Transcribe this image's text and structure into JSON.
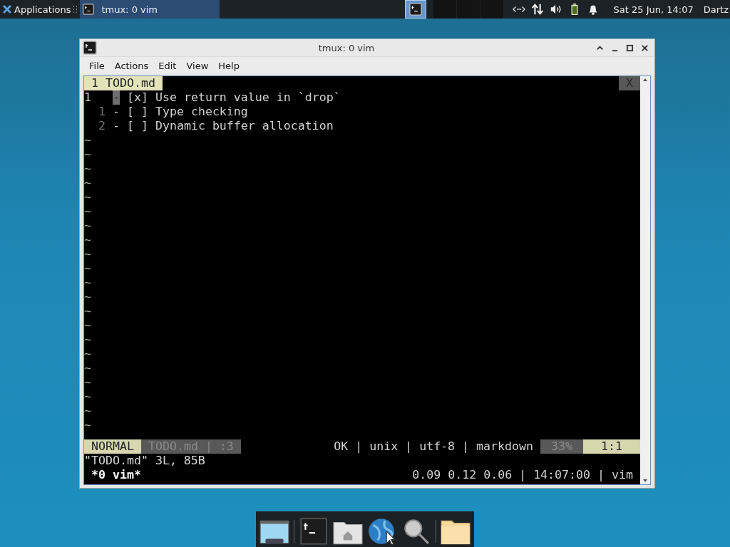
{
  "top_panel": {
    "applications": "Applications",
    "tasks": [
      {
        "title": "tmux: 0 vim",
        "selected": true
      }
    ],
    "workspaces": [
      {
        "selected": true
      },
      {
        "selected": false
      },
      {
        "selected": false
      },
      {
        "selected": false
      }
    ],
    "clock": "Sat 25 Jun, 14:07",
    "user": "Dartz"
  },
  "window": {
    "title": "tmux: 0 vim",
    "menu": [
      "File",
      "Actions",
      "Edit",
      "View",
      "Help"
    ],
    "terminal": {
      "tabs": [
        {
          "label": "1 TODO.md",
          "selected": true
        }
      ],
      "tab_close": "X",
      "lines": [
        {
          "number": "1",
          "marker": "-",
          "text": "[x] Use return value in `drop`",
          "current": true
        },
        {
          "number": "1",
          "marker": "-",
          "text": "[ ] Type checking",
          "current": false
        },
        {
          "number": "2",
          "marker": "-",
          "text": "[ ] Dynamic buffer allocation",
          "current": false
        }
      ],
      "empty_lines": [
        "~",
        "~",
        "~",
        "~",
        "~",
        "~",
        "~",
        "~",
        "~",
        "~",
        "~",
        "~",
        "~",
        "~",
        "~",
        "~",
        "~",
        "~",
        "~",
        "~",
        "~"
      ],
      "statusline": {
        "mode": "NORMAL",
        "file": "TODO.md | :3",
        "info": "OK | unix | utf-8 | markdown",
        "percent": "33%",
        "position": "1:1"
      },
      "message": "\"TODO.md\" 3L, 85B",
      "tmux_bar": {
        "window": "*0 vim*",
        "right": "0.09 0.12 0.06 | 14:07:00 | vim"
      }
    }
  }
}
